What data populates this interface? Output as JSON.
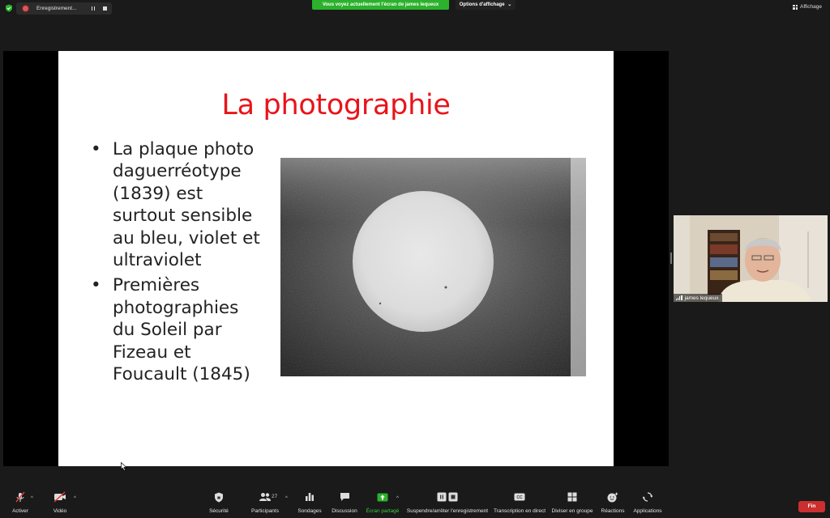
{
  "top_bar": {
    "recording_label": "Enregistrement...",
    "share_banner": "Vous voyez actuellement l'écran de james lequeux",
    "view_options": "Options d'affichage",
    "view_options_chevron": "⌄",
    "view_label": "Affichage"
  },
  "slide": {
    "title": "La photographie",
    "bullet_glyph": "•",
    "bullets": [
      "La plaque photo\ndaguerréotype\n(1839) est\nsurtout sensible\nau bleu, violet et\nultraviolet",
      "Premières\nphotographies\ndu Soleil par\nFizeau et\nFoucault (1845)"
    ]
  },
  "speaker": {
    "name": "james lequeux"
  },
  "toolbar": {
    "caret": "^",
    "mute_label": "Activer",
    "video_label": "Vidéo",
    "security_label": "Sécurité",
    "participants_label": "Participants",
    "participants_count": "27",
    "polls_label": "Sondages",
    "chat_label": "Discussion",
    "share_label": "Écran partagé",
    "record_label": "Suspendre/arrêter l'enregistrement",
    "cc_glyph": "CC",
    "transcript_label": "Transcription en direct",
    "breakout_label": "Diviser en groupe",
    "reactions_label": "Réactions",
    "apps_label": "Applications",
    "end_label": "Fin"
  },
  "colors": {
    "title_red": "#e8141a",
    "share_green": "#2bb12b",
    "end_red": "#cc2f2f",
    "background": "#1a1a1a"
  }
}
